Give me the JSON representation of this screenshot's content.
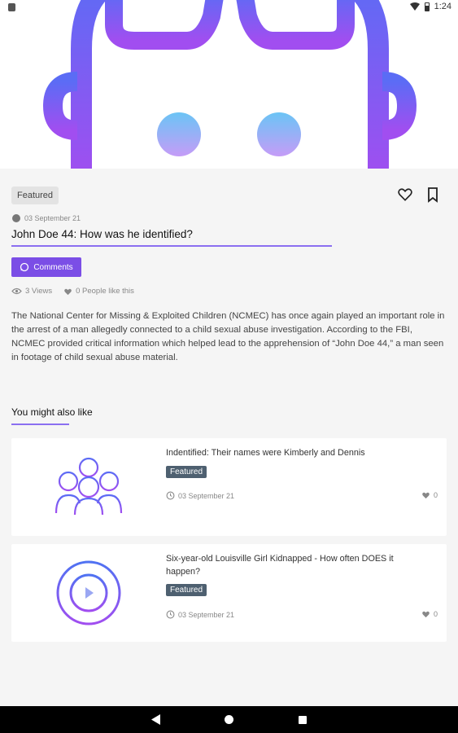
{
  "status_bar": {
    "time": "1:24"
  },
  "article": {
    "badge": "Featured",
    "date": "03 September 21",
    "title": "John Doe 44: How was he identified?",
    "comments_label": "Comments",
    "views": "3 Views",
    "likes": "0 People like this",
    "body": "The National Center for Missing & Exploited Children (NCMEC) has once again played an important role in the arrest of a man allegedly connected to a child sexual abuse investigation. According to the FBI, NCMEC provided critical information which helped lead to the apprehension of “John Doe 44,” a man seen in footage of child sexual abuse material."
  },
  "related": {
    "heading": "You might also like",
    "items": [
      {
        "title": "Indentified: Their names were Kimberly and Dennis",
        "badge": "Featured",
        "date": "03 September 21",
        "likes": "0",
        "thumb_icon": "group-people-icon"
      },
      {
        "title": "Six-year-old Louisville Girl Kidnapped - How often DOES it happen?",
        "badge": "Featured",
        "date": "03 September 21",
        "likes": "0",
        "thumb_icon": "play-circle-icon"
      }
    ]
  },
  "colors": {
    "accent": "#7b4ee6",
    "gradient_start": "#5b6cf5",
    "gradient_end": "#a14ef0",
    "badge_dark": "#4e6070"
  }
}
